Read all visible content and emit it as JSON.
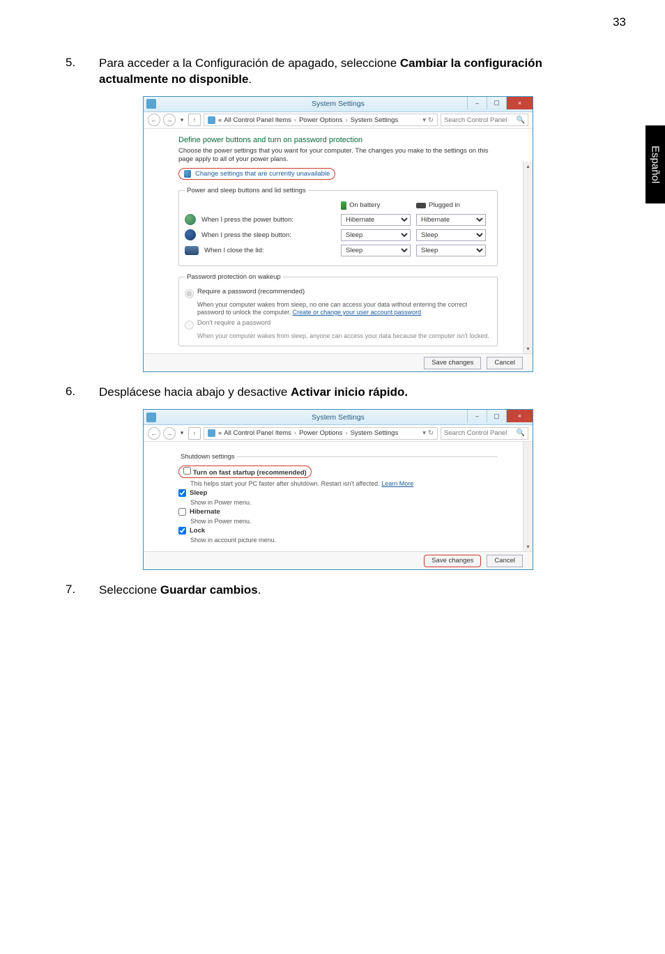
{
  "page_number": "33",
  "side_tab": "Español",
  "step5": {
    "num": "5.",
    "text_a": "Para acceder a la Configuración de apagado, seleccione ",
    "bold": "Cambiar la configuración actualmente no disponible",
    "text_b": "."
  },
  "step6": {
    "num": "6.",
    "text_a": "Desplácese hacia abajo y desactive ",
    "bold": "Activar inicio rápido."
  },
  "step7": {
    "num": "7.",
    "text_a": "Seleccione ",
    "bold": "Guardar cambios",
    "text_b": "."
  },
  "win": {
    "title": "System Settings",
    "minimize": "–",
    "maximize": "▢",
    "close": "×",
    "back": "←",
    "fwd": "→",
    "hist": "▾",
    "up": "↑",
    "bc_prefix": "«",
    "bc1": "All Control Panel Items",
    "bc2": "Power Options",
    "bc3": "System Settings",
    "bc_sep": "›",
    "bc_end": "▾",
    "refresh": "↻",
    "search_ph": "Search Control Panel",
    "mag": "🔍"
  },
  "scr1": {
    "heading": "Define power buttons and turn on password protection",
    "intro": "Choose the power settings that you want for your computer. The changes you make to the settings on this page apply to all of your power plans.",
    "change_link": "Change settings that are currently unavailable",
    "group1_legend": "Power and sleep buttons and lid settings",
    "col_battery": "On battery",
    "col_plugged": "Plugged in",
    "row_power": "When I press the power button:",
    "row_sleep": "When I press the sleep button:",
    "row_lid": "When I close the lid:",
    "opt_hibernate": "Hibernate",
    "opt_sleep": "Sleep",
    "group2_legend": "Password protection on wakeup",
    "r1_label": "Require a password (recommended)",
    "r1_desc_a": "When your computer wakes from sleep, no one can access your data without entering the correct password to unlock the computer. ",
    "r1_link": "Create or change your user account password",
    "r2_label": "Don't require a password",
    "r2_desc": "When your computer wakes from sleep, anyone can access your data because the computer isn't locked.",
    "save": "Save changes",
    "cancel": "Cancel",
    "scroll_up": "▴",
    "scroll_down": "▾"
  },
  "scr2": {
    "legend": "Shutdown settings",
    "fast": "Turn on fast startup (recommended)",
    "fast_desc": "This helps start your PC faster after shutdown. Restart isn't affected. ",
    "learn": "Learn More",
    "sleep": "Sleep",
    "sleep_desc": "Show in Power menu.",
    "hibernate": "Hibernate",
    "hibernate_desc": "Show in Power menu.",
    "lock": "Lock",
    "lock_desc": "Show in account picture menu.",
    "save": "Save changes",
    "cancel": "Cancel",
    "scroll_down": "▾"
  }
}
